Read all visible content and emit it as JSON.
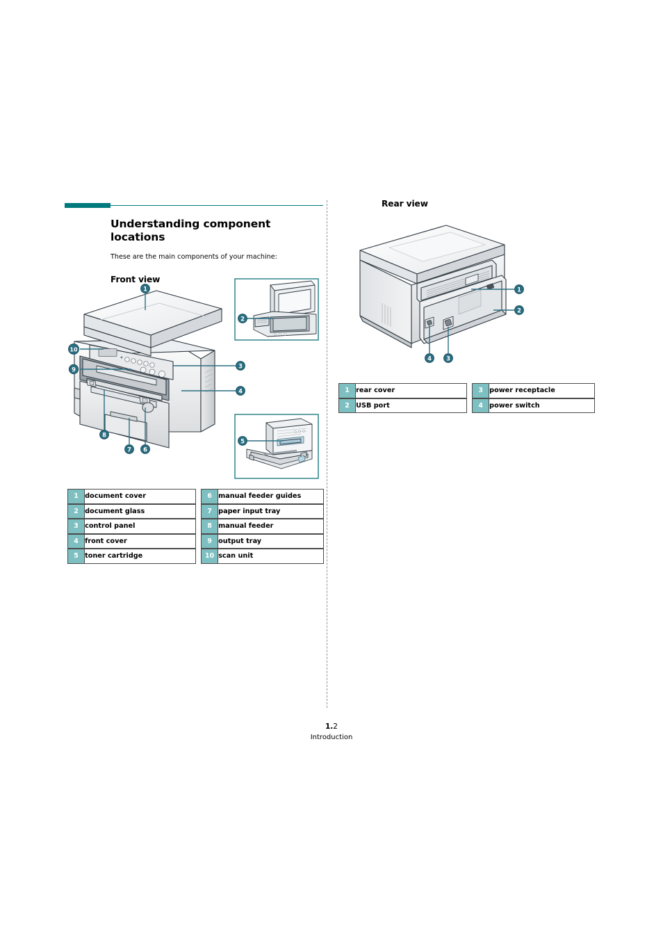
{
  "page": {
    "title": "Understanding component locations",
    "intro": "These are the main components of your machine:",
    "front_heading": "Front view",
    "rear_heading": "Rear view",
    "accent_dark": "#007a7c",
    "accent_light": "#7ec0c1",
    "callout_color": "#2a6e81"
  },
  "footer": {
    "page_number_bold": "1.",
    "page_number_rest": "2",
    "chapter": "Introduction"
  },
  "front_legend": {
    "rows": [
      {
        "num_left": "1",
        "label_left": "document cover",
        "num_right": "6",
        "label_right": "manual feeder guides"
      },
      {
        "num_left": "2",
        "label_left": "document glass",
        "num_right": "7",
        "label_right": "paper input tray"
      },
      {
        "num_left": "3",
        "label_left": "control panel",
        "num_right": "8",
        "label_right": "manual feeder"
      },
      {
        "num_left": "4",
        "label_left": "front cover",
        "num_right": "9",
        "label_right": "output tray"
      },
      {
        "num_left": "5",
        "label_left": "toner cartridge",
        "num_right": "10",
        "label_right": "scan unit"
      }
    ]
  },
  "rear_legend": {
    "rows": [
      {
        "num_left": "1",
        "label_left": "rear cover",
        "num_right": "3",
        "label_right": "power receptacle"
      },
      {
        "num_left": "2",
        "label_left": "USB port",
        "num_right": "4",
        "label_right": "power switch"
      }
    ]
  },
  "front_figure": {
    "callouts": [
      {
        "id": "1",
        "label": "document cover"
      },
      {
        "id": "2",
        "label": "document glass"
      },
      {
        "id": "3",
        "label": "control panel"
      },
      {
        "id": "4",
        "label": "front cover"
      },
      {
        "id": "5",
        "label": "toner cartridge"
      },
      {
        "id": "6",
        "label": "manual feeder guides"
      },
      {
        "id": "7",
        "label": "paper input tray"
      },
      {
        "id": "8",
        "label": "manual feeder"
      },
      {
        "id": "9",
        "label": "output tray"
      },
      {
        "id": "10",
        "label": "scan unit"
      }
    ]
  },
  "rear_figure": {
    "callouts": [
      {
        "id": "1",
        "label": "rear cover"
      },
      {
        "id": "2",
        "label": "USB port"
      },
      {
        "id": "3",
        "label": "power receptacle"
      },
      {
        "id": "4",
        "label": "power switch"
      }
    ]
  }
}
